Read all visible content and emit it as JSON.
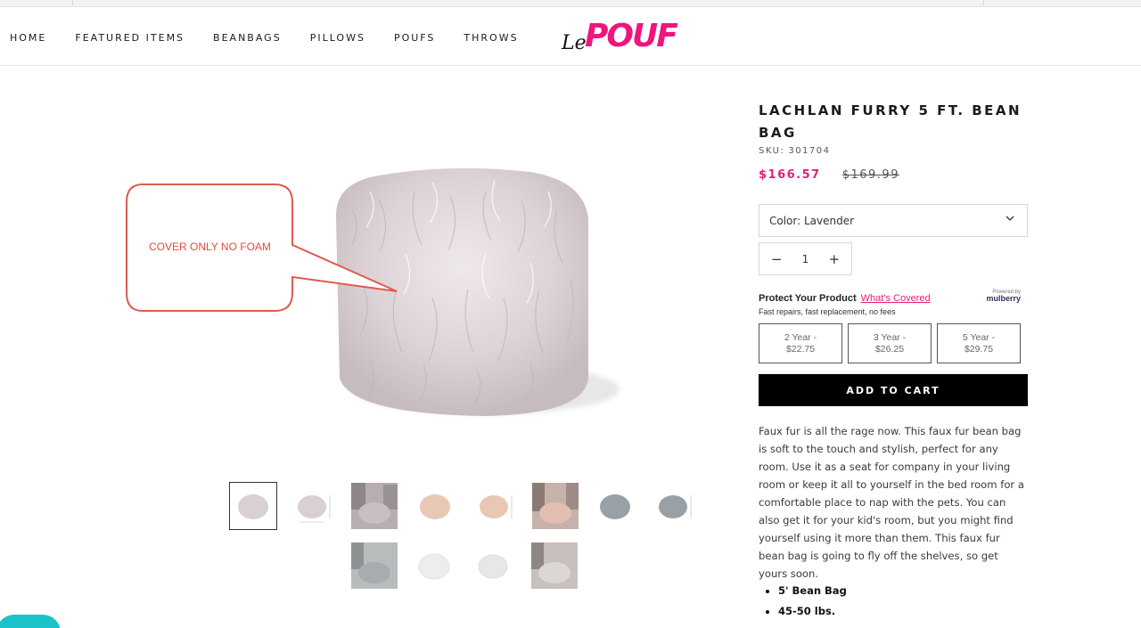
{
  "nav": {
    "items": [
      "HOME",
      "FEATURED ITEMS",
      "BEANBAGS",
      "PILLOWS",
      "POUFS",
      "THROWS"
    ]
  },
  "logo": {
    "prefix": "Le",
    "name": "POUF"
  },
  "callout": {
    "text": "COVER ONLY NO FOAM"
  },
  "product": {
    "title": "LACHLAN FURRY 5 FT. BEAN BAG",
    "sku_label": "SKU:",
    "sku": "301704",
    "price_sale": "$166.57",
    "price_original": "$169.99",
    "color_select": "Color: Lavender",
    "quantity": "1",
    "minus": "−",
    "plus": "+"
  },
  "protection": {
    "heading": "Protect Your Product",
    "link": "What's Covered",
    "subtext": "Fast repairs, fast replacement, no fees",
    "powered_by": "Powered by",
    "brand": "mulberry",
    "plans": [
      {
        "term": "2 Year -",
        "price": "$22.75"
      },
      {
        "term": "3 Year -",
        "price": "$26.25"
      },
      {
        "term": "5 Year -",
        "price": "$29.75"
      }
    ]
  },
  "cart": {
    "label": "ADD TO CART"
  },
  "description": "Faux fur is all the rage now. This faux fur bean bag is soft to the touch and stylish, perfect for any room. Use it as a seat for company in your living room or keep it all to yourself in the bed room for a comfortable place to nap with the pets. You can also get it for your kid's room, but you might find yourself using it more than them. This faux fur bean bag is going to fly off the shelves, so get yours soon.",
  "bullets": [
    "5' Bean Bag",
    "45-50 lbs."
  ],
  "thumbnails": [
    {
      "color": "#d8d0d2",
      "scene": "plain"
    },
    {
      "color": "#d8d0d2",
      "scene": "dim"
    },
    {
      "color": "#c9bfc2",
      "scene": "room"
    },
    {
      "color": "#e8c8b4",
      "scene": "plain"
    },
    {
      "color": "#e8c8b4",
      "scene": "dim"
    },
    {
      "color": "#e2bfb2",
      "scene": "room"
    },
    {
      "color": "#9aa1a6",
      "scene": "plain"
    },
    {
      "color": "#9aa1a6",
      "scene": "dim"
    },
    {
      "color": "#a8acae",
      "scene": "room"
    },
    {
      "color": "#eceeec",
      "scene": "plain"
    },
    {
      "color": "#e6e8e6",
      "scene": "dim"
    },
    {
      "color": "#dcd6d4",
      "scene": "room"
    }
  ],
  "colors": {
    "accent": "#e0227a",
    "logo": "#f0147f",
    "chat": "#1cc2c9"
  }
}
